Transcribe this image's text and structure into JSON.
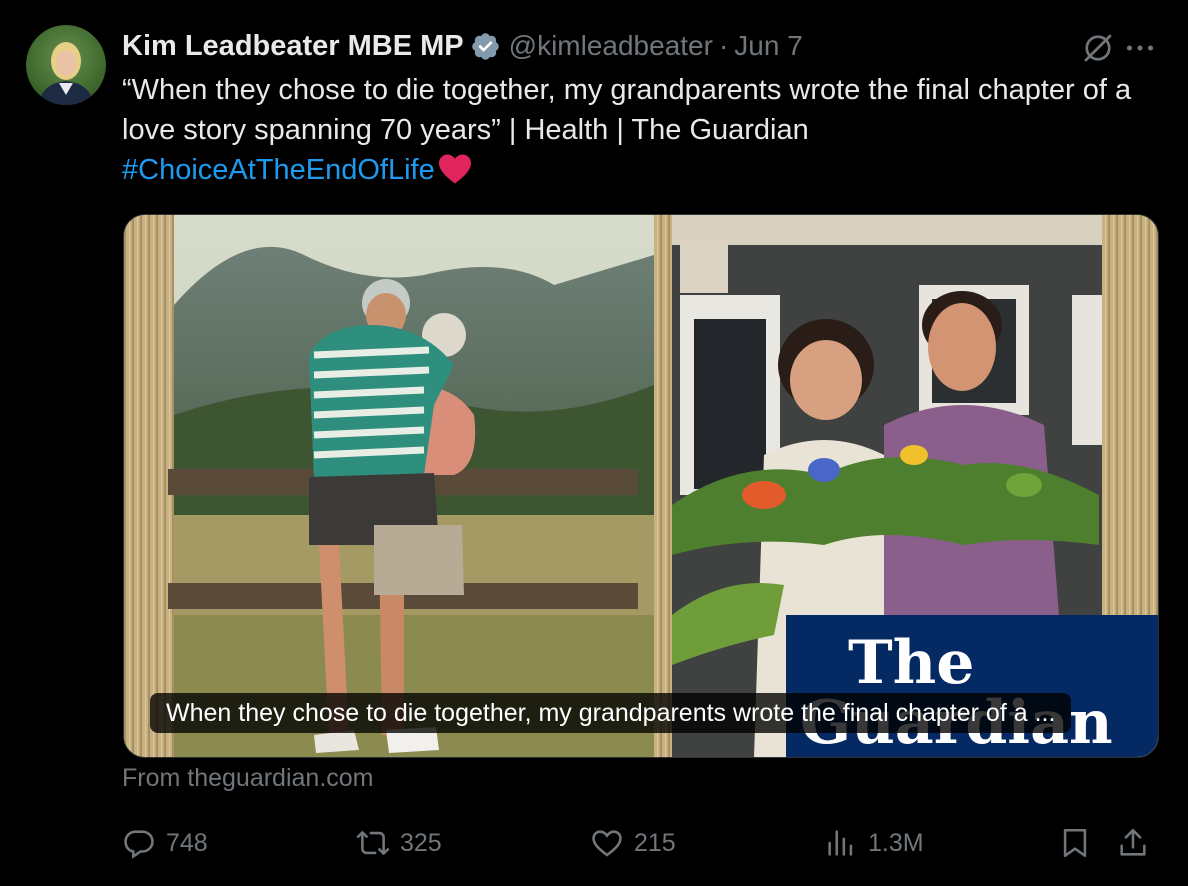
{
  "tweet": {
    "author_name": "Kim Leadbeater MBE MP",
    "handle": "@kimleadbeater",
    "separator": "·",
    "date": "Jun 7",
    "text_main": "“When they chose to die together, my grandparents wrote the final chapter of a love story spanning 70 years” | Health | The Guardian",
    "hashtag": "#ChoiceAtTheEndOfLife",
    "emoji": "red-heart"
  },
  "card": {
    "caption": "When they chose to die together, my grandparents wrote the final chapter of a ...",
    "logo_text": "The Guardian",
    "source": "From theguardian.com"
  },
  "actions": {
    "replies": "748",
    "reposts": "325",
    "likes": "215",
    "views": "1.3M"
  },
  "icons": [
    "verified-badge-icon",
    "grok-icon",
    "more-icon",
    "reply-icon",
    "repost-icon",
    "like-icon",
    "views-icon",
    "bookmark-icon",
    "share-icon"
  ],
  "colors": {
    "background": "#000000",
    "text": "#e7e9ea",
    "muted": "#71767b",
    "accent": "#1d9bf0",
    "guardian_blue": "#052962"
  }
}
